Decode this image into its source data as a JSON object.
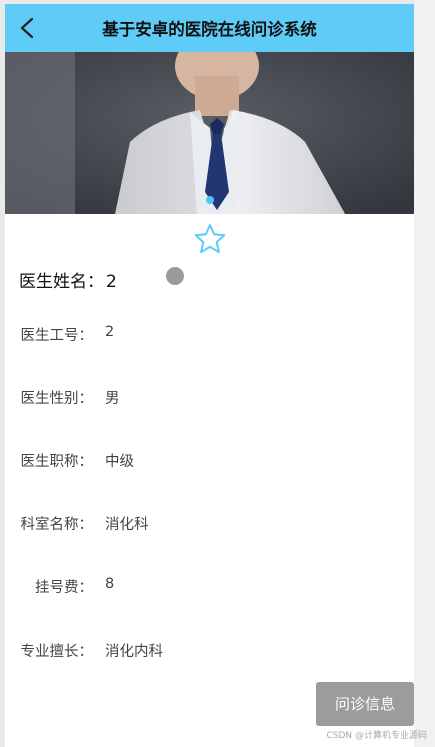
{
  "header": {
    "title": "基于安卓的医院在线问诊系统",
    "back_icon": "chevron-left-icon",
    "background": "#5fcbf7"
  },
  "favorite": {
    "icon": "star-outline-icon",
    "color": "#5fcbf7"
  },
  "doctor": {
    "name_label": "医生姓名：",
    "name_value": "2",
    "fields": [
      {
        "label": "医生工号：",
        "value": "2"
      },
      {
        "label": "医生性别：",
        "value": "男"
      },
      {
        "label": "医生职称：",
        "value": "中级"
      },
      {
        "label": "科室名称：",
        "value": "消化科"
      },
      {
        "label": "挂号费：",
        "value": "8"
      },
      {
        "label": "专业擅长：",
        "value": "消化内科"
      }
    ]
  },
  "actions": {
    "consult_label": "问诊信息"
  },
  "watermark": "CSDN @计算机专业源码"
}
